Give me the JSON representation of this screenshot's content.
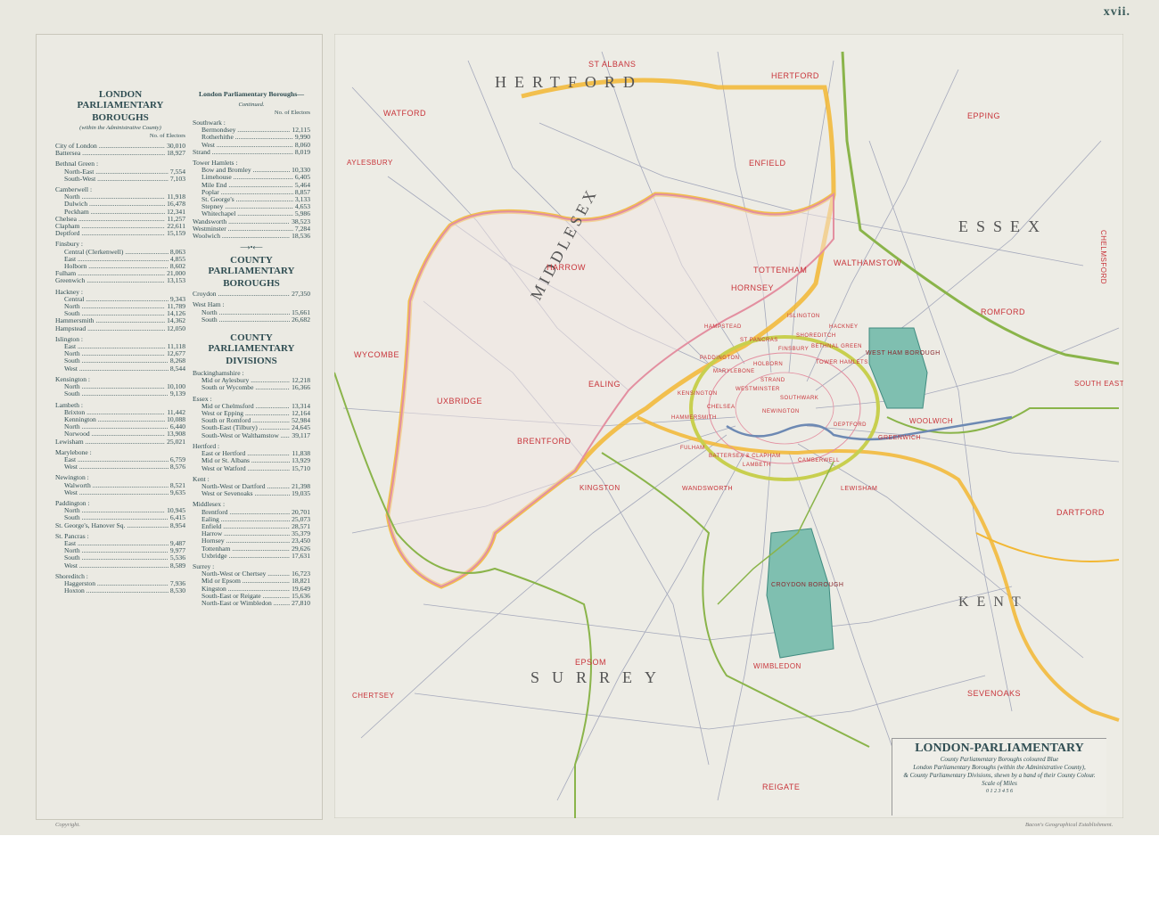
{
  "page_number": "xvii.",
  "left_panel": {
    "col1": {
      "title1": "LONDON PARLIAMENTARY",
      "title2": "BOROUGHS",
      "subtitle": "(within the Administrative County)",
      "header_note": "No. of Electors",
      "rows": [
        {
          "type": "row",
          "name": "City of London",
          "value": "30,010"
        },
        {
          "type": "row",
          "name": "Battersea",
          "value": "18,927"
        },
        {
          "type": "grp",
          "name": "Bethnal Green :"
        },
        {
          "type": "sub",
          "name": "North-East",
          "value": "7,554"
        },
        {
          "type": "sub",
          "name": "South-West",
          "value": "7,103"
        },
        {
          "type": "grp",
          "name": "Camberwell :"
        },
        {
          "type": "sub",
          "name": "North",
          "value": "11,918"
        },
        {
          "type": "sub",
          "name": "Dulwich",
          "value": "16,478"
        },
        {
          "type": "sub",
          "name": "Peckham",
          "value": "12,341"
        },
        {
          "type": "row",
          "name": "Chelsea",
          "value": "11,257"
        },
        {
          "type": "row",
          "name": "Clapham",
          "value": "22,611"
        },
        {
          "type": "row",
          "name": "Deptford",
          "value": "15,159"
        },
        {
          "type": "grp",
          "name": "Finsbury :"
        },
        {
          "type": "sub",
          "name": "Central (Clerkenwell)",
          "value": "8,063"
        },
        {
          "type": "sub",
          "name": "East",
          "value": "4,855"
        },
        {
          "type": "sub",
          "name": "Holborn",
          "value": "8,602"
        },
        {
          "type": "row",
          "name": "Fulham",
          "value": "21,000"
        },
        {
          "type": "row",
          "name": "Greenwich",
          "value": "13,153"
        },
        {
          "type": "grp",
          "name": "Hackney :"
        },
        {
          "type": "sub",
          "name": "Central",
          "value": "9,343"
        },
        {
          "type": "sub",
          "name": "North",
          "value": "11,789"
        },
        {
          "type": "sub",
          "name": "South",
          "value": "14,126"
        },
        {
          "type": "row",
          "name": "Hammersmith",
          "value": "14,362"
        },
        {
          "type": "row",
          "name": "Hampstead",
          "value": "12,050"
        },
        {
          "type": "grp",
          "name": "Islington :"
        },
        {
          "type": "sub",
          "name": "East",
          "value": "11,118"
        },
        {
          "type": "sub",
          "name": "North",
          "value": "12,677"
        },
        {
          "type": "sub",
          "name": "South",
          "value": "8,268"
        },
        {
          "type": "sub",
          "name": "West",
          "value": "8,544"
        },
        {
          "type": "grp",
          "name": "Kensington :"
        },
        {
          "type": "sub",
          "name": "North",
          "value": "10,100"
        },
        {
          "type": "sub",
          "name": "South",
          "value": "9,139"
        },
        {
          "type": "grp",
          "name": "Lambeth :"
        },
        {
          "type": "sub",
          "name": "Brixton",
          "value": "11,442"
        },
        {
          "type": "sub",
          "name": "Kennington",
          "value": "10,088"
        },
        {
          "type": "sub",
          "name": "North",
          "value": "6,440"
        },
        {
          "type": "sub",
          "name": "Norwood",
          "value": "13,908"
        },
        {
          "type": "row",
          "name": "Lewisham",
          "value": "25,021"
        },
        {
          "type": "grp",
          "name": "Marylebone :"
        },
        {
          "type": "sub",
          "name": "East",
          "value": "6,759"
        },
        {
          "type": "sub",
          "name": "West",
          "value": "8,576"
        },
        {
          "type": "grp",
          "name": "Newington :"
        },
        {
          "type": "sub",
          "name": "Walworth",
          "value": "8,521"
        },
        {
          "type": "sub",
          "name": "West",
          "value": "9,635"
        },
        {
          "type": "grp",
          "name": "Paddington :"
        },
        {
          "type": "sub",
          "name": "North",
          "value": "10,945"
        },
        {
          "type": "sub",
          "name": "South",
          "value": "6,415"
        },
        {
          "type": "row",
          "name": "St. George's, Hanover Sq.",
          "value": "8,954"
        },
        {
          "type": "grp",
          "name": "St. Pancras :"
        },
        {
          "type": "sub",
          "name": "East",
          "value": "9,487"
        },
        {
          "type": "sub",
          "name": "North",
          "value": "9,977"
        },
        {
          "type": "sub",
          "name": "South",
          "value": "5,536"
        },
        {
          "type": "sub",
          "name": "West",
          "value": "8,589"
        },
        {
          "type": "grp",
          "name": "Shoreditch :"
        },
        {
          "type": "sub",
          "name": "Haggerston",
          "value": "7,936"
        },
        {
          "type": "sub",
          "name": "Hoxton",
          "value": "8,530"
        }
      ]
    },
    "col2": {
      "title": "London Parliamentary Boroughs—",
      "subtitle": "Continued.",
      "header_note": "No. of Electors",
      "rows": [
        {
          "type": "grp",
          "name": "Southwark :"
        },
        {
          "type": "sub",
          "name": "Bermondsey",
          "value": "12,115"
        },
        {
          "type": "sub",
          "name": "Rotherhithe",
          "value": "9,990"
        },
        {
          "type": "sub",
          "name": "West",
          "value": "8,060"
        },
        {
          "type": "row",
          "name": "Strand",
          "value": "8,019"
        },
        {
          "type": "grp",
          "name": "Tower Hamlets :"
        },
        {
          "type": "sub",
          "name": "Bow and Bromley",
          "value": "10,330"
        },
        {
          "type": "sub",
          "name": "Limehouse",
          "value": "6,405"
        },
        {
          "type": "sub",
          "name": "Mile End",
          "value": "5,464"
        },
        {
          "type": "sub",
          "name": "Poplar",
          "value": "8,857"
        },
        {
          "type": "sub",
          "name": "St. George's",
          "value": "3,133"
        },
        {
          "type": "sub",
          "name": "Stepney",
          "value": "4,653"
        },
        {
          "type": "sub",
          "name": "Whitechapel",
          "value": "5,986"
        },
        {
          "type": "row",
          "name": "Wandsworth",
          "value": "38,523"
        },
        {
          "type": "row",
          "name": "Westminster",
          "value": "7,284"
        },
        {
          "type": "row",
          "name": "Woolwich",
          "value": "18,536"
        }
      ],
      "section2_title1": "COUNTY PARLIAMENTARY",
      "section2_title2": "BOROUGHS",
      "section2_rows": [
        {
          "type": "row",
          "name": "Croydon",
          "value": "27,350"
        },
        {
          "type": "grp",
          "name": "West Ham :"
        },
        {
          "type": "sub",
          "name": "North",
          "value": "15,661"
        },
        {
          "type": "sub",
          "name": "South",
          "value": "26,682"
        }
      ],
      "section3_title1": "COUNTY PARLIAMENTARY",
      "section3_title2": "DIVISIONS",
      "section3_rows": [
        {
          "type": "grp",
          "name": "Buckinghamshire :"
        },
        {
          "type": "sub",
          "name": "Mid or Aylesbury",
          "value": "12,218"
        },
        {
          "type": "sub",
          "name": "South or Wycombe",
          "value": "16,366"
        },
        {
          "type": "grp",
          "name": "Essex :"
        },
        {
          "type": "sub",
          "name": "Mid or Chelmsford",
          "value": "13,314"
        },
        {
          "type": "sub",
          "name": "West or Epping",
          "value": "12,164"
        },
        {
          "type": "sub",
          "name": "South or Romford",
          "value": "52,984"
        },
        {
          "type": "sub",
          "name": "South-East (Tilbury)",
          "value": "24,645"
        },
        {
          "type": "sub",
          "name": "South-West or Walthamstow",
          "value": "39,117"
        },
        {
          "type": "grp",
          "name": "Hertford :"
        },
        {
          "type": "sub",
          "name": "East or Hertford",
          "value": "11,838"
        },
        {
          "type": "sub",
          "name": "Mid or St. Albans",
          "value": "13,929"
        },
        {
          "type": "sub",
          "name": "West or Watford",
          "value": "15,710"
        },
        {
          "type": "grp",
          "name": "Kent :"
        },
        {
          "type": "sub",
          "name": "North-West or Dartford",
          "value": "21,398"
        },
        {
          "type": "sub",
          "name": "West or Sevenoaks",
          "value": "19,035"
        },
        {
          "type": "grp",
          "name": "Middlesex :"
        },
        {
          "type": "sub",
          "name": "Brentford",
          "value": "20,701"
        },
        {
          "type": "sub",
          "name": "Ealing",
          "value": "25,073"
        },
        {
          "type": "sub",
          "name": "Enfield",
          "value": "28,571"
        },
        {
          "type": "sub",
          "name": "Harrow",
          "value": "35,379"
        },
        {
          "type": "sub",
          "name": "Hornsey",
          "value": "23,450"
        },
        {
          "type": "sub",
          "name": "Tottenham",
          "value": "29,626"
        },
        {
          "type": "sub",
          "name": "Uxbridge",
          "value": "17,631"
        },
        {
          "type": "grp",
          "name": "Surrey :"
        },
        {
          "type": "sub",
          "name": "North-West or Chertsey",
          "value": "16,723"
        },
        {
          "type": "sub",
          "name": "Mid or Epsom",
          "value": "18,821"
        },
        {
          "type": "sub",
          "name": "Kingston",
          "value": "19,649"
        },
        {
          "type": "sub",
          "name": "South-East or Reigate",
          "value": "15,636"
        },
        {
          "type": "sub",
          "name": "North-East or Wimbledon",
          "value": "27,810"
        }
      ]
    }
  },
  "footer": {
    "left": "Copyright.",
    "right": "Bacon's Geographical Establishment."
  },
  "map": {
    "county_labels": [
      "HERTFORD",
      "ESSEX",
      "MIDDLESEX",
      "SURREY",
      "KENT"
    ],
    "division_labels": [
      "ST ALBANS",
      "HERTFORD",
      "WATFORD",
      "ENFIELD",
      "EPPING",
      "AYLESBURY",
      "CHELMSFORD",
      "HARROW",
      "TOTTENHAM",
      "HORNSEY",
      "WALTHAMSTOW",
      "ROMFORD",
      "WYCOMBE",
      "UXBRIDGE",
      "EALING",
      "BRENTFORD",
      "KINGSTON",
      "WEST HAM BOROUGH",
      "WOOLWICH",
      "SOUTH EASTERN",
      "DARTFORD",
      "CROYDON BOROUGH",
      "WIMBLEDON",
      "EPSOM",
      "CHERTSEY",
      "REIGATE",
      "SEVENOAKS",
      "WANDSWORTH",
      "LEWISHAM",
      "GREENWICH",
      "HAMPSTEAD",
      "ISLINGTON",
      "HACKNEY",
      "LAMBETH",
      "CAMBERWELL",
      "BATTERSEA & CLAPHAM",
      "FULHAM",
      "HAMMERSMITH",
      "ST PANCRAS",
      "FINSBURY",
      "PADDINGTON",
      "MARYLEBONE",
      "KENSINGTON",
      "CHELSEA",
      "WESTMINSTER",
      "STRAND",
      "SOUTHWARK",
      "DEPTFORD",
      "TOWER HAMLETS",
      "BETHNAL GREEN",
      "SHOREDITCH",
      "HOLBORN",
      "NEWINGTON"
    ],
    "colors": {
      "county_border": "#f2b733",
      "division_border": "#8ab44a",
      "middlesex_border": "#e38fa0",
      "roads": "#9aa0b5",
      "county_borough_fill": "#7fbfb0",
      "label_red": "#c8343a",
      "label_dark": "#5b5b5b"
    }
  },
  "legend": {
    "title": "LONDON-PARLIAMENTARY",
    "line1": "County Parliamentary Boroughs coloured Blue",
    "line2": "London Parliamentary Boroughs (within the Administrative County),",
    "line3": "& County Parliamentary Divisions, shewn by a band of their County Colour.",
    "scale_label": "Scale of Miles",
    "scale_ticks": "0  1  2  3  4  5  6"
  }
}
